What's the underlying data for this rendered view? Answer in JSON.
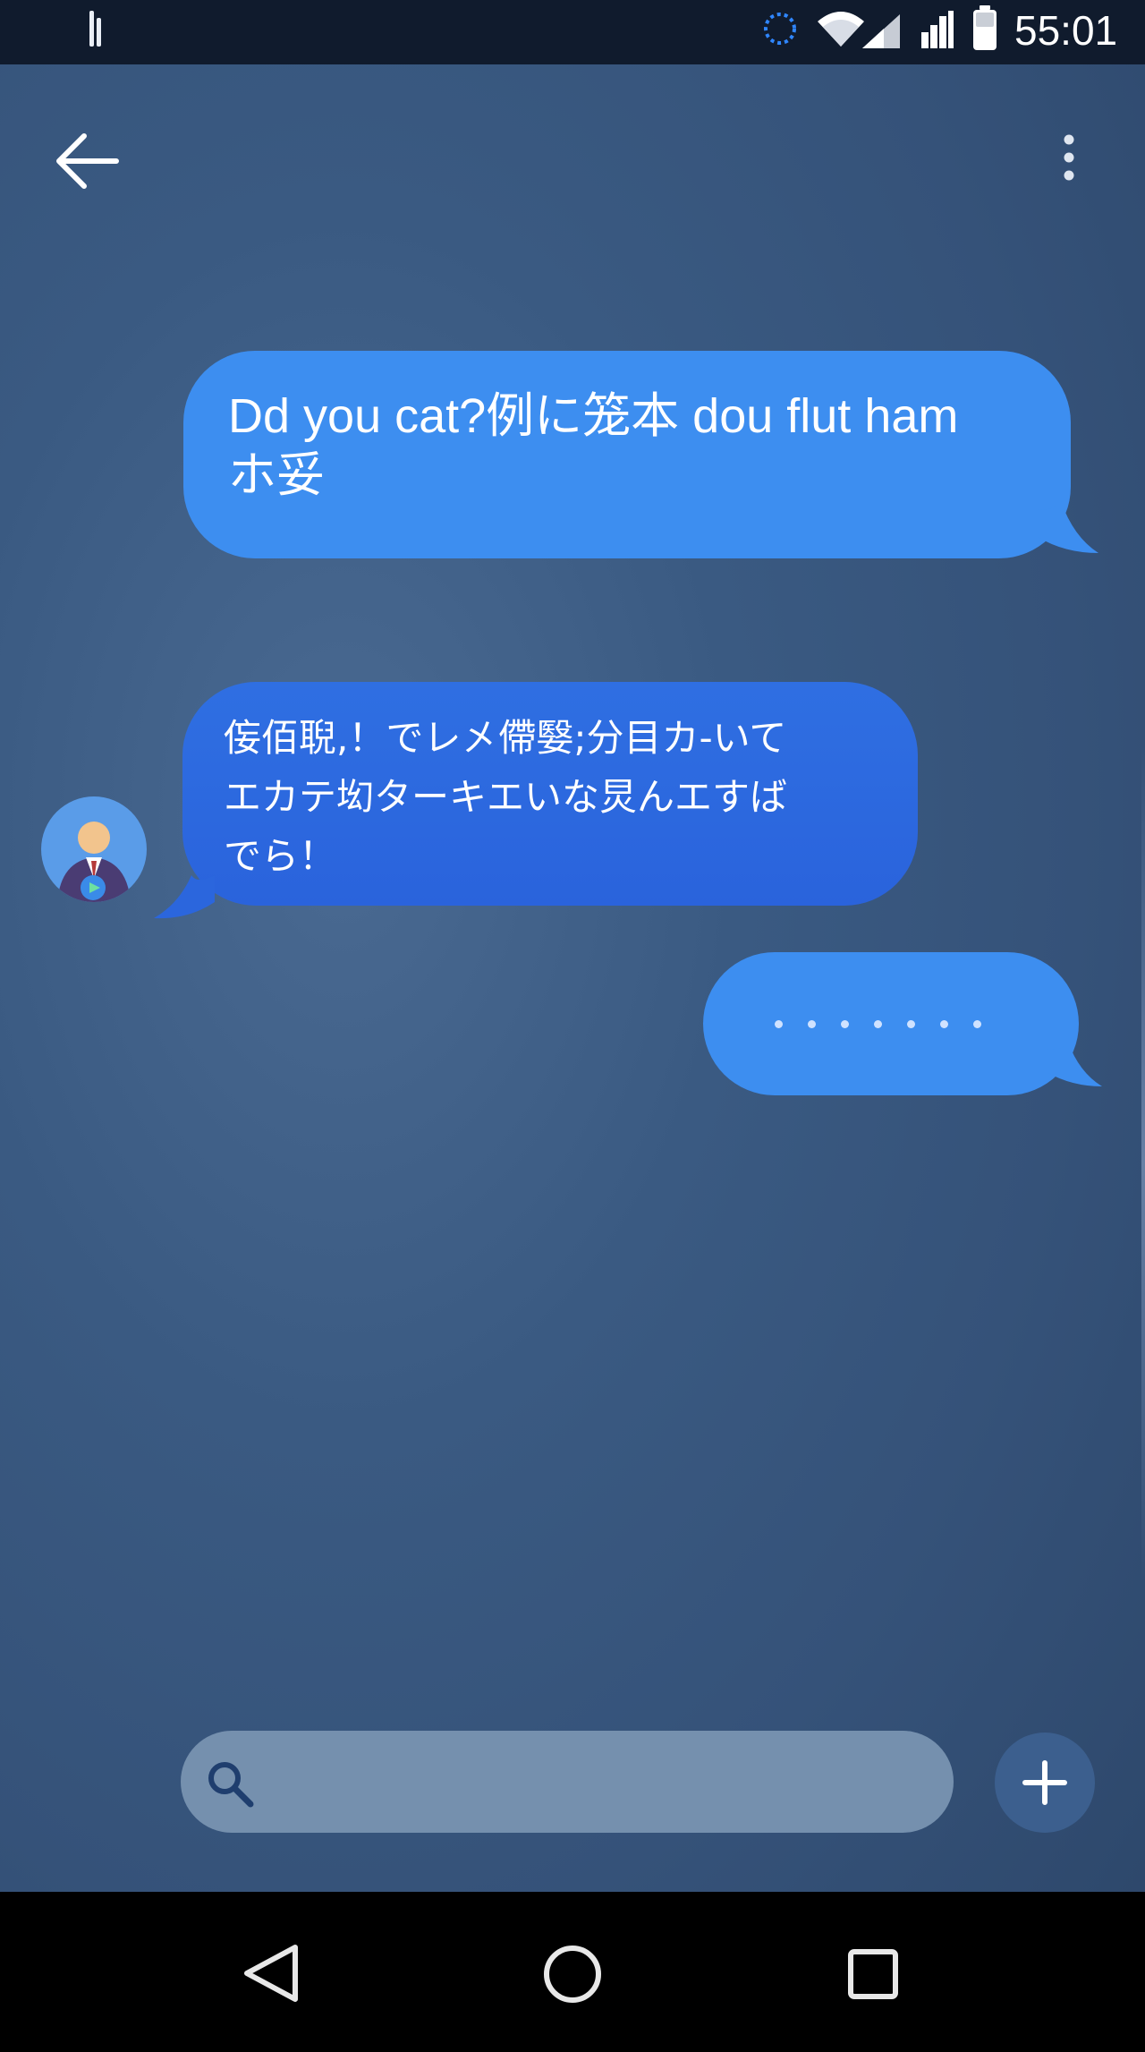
{
  "status_bar": {
    "time": "55:01",
    "icons": [
      "sync-icon",
      "wifi-icon",
      "cell-signal-icon",
      "cell-signal-icon",
      "battery-icon"
    ]
  },
  "top_bar": {
    "back_icon": "arrow-left-icon",
    "menu_icon": "more-vert-icon"
  },
  "messages": [
    {
      "sender": "self",
      "text": "Dd you cat?例に笼本 dou flut ham\nホ妥"
    },
    {
      "sender": "other",
      "text": "侫佰聣,！でレ㐅僀嫛;分目カ-いて\nエカテ㘭ターキエいな炅んエすば\nでら！"
    },
    {
      "sender": "self",
      "typing": true,
      "text": "· · · · · · ·"
    }
  ],
  "composer": {
    "search_placeholder": "",
    "search_icon": "search-icon",
    "add_icon": "plus-icon"
  },
  "nav_bar": {
    "icons": [
      "nav-back-icon",
      "nav-home-icon",
      "nav-recents-icon"
    ]
  },
  "colors": {
    "bubble_self": "#3d8ef0",
    "bubble_other": "#2b66dd",
    "background": "#3a5a82",
    "status_bar": "#101b2d",
    "composer_input": "#7590ae",
    "add_button": "#3c5f8e"
  }
}
